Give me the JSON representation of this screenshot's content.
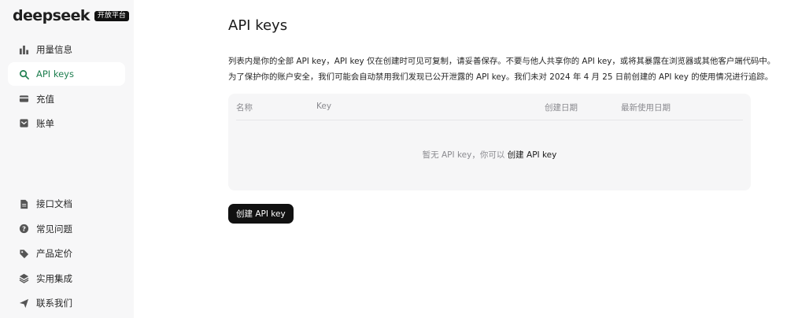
{
  "brand": {
    "name": "deepseek",
    "badge": "开放平台"
  },
  "sidebar": {
    "top_items": [
      {
        "label": "用量信息",
        "icon": "bar-chart-icon"
      },
      {
        "label": "API keys",
        "icon": "search-icon",
        "active": true
      },
      {
        "label": "充值",
        "icon": "wallet-icon"
      },
      {
        "label": "账单",
        "icon": "inbox-icon"
      }
    ],
    "bottom_items": [
      {
        "label": "接口文档",
        "icon": "document-icon"
      },
      {
        "label": "常见问题",
        "icon": "question-icon"
      },
      {
        "label": "产品定价",
        "icon": "tag-icon"
      },
      {
        "label": "实用集成",
        "icon": "layers-icon"
      },
      {
        "label": "联系我们",
        "icon": "send-icon"
      }
    ]
  },
  "main": {
    "title": "API keys",
    "description_line1": "列表内是你的全部 API key，API key 仅在创建时可见可复制，请妥善保存。不要与他人共享你的 API key，或将其暴露在浏览器或其他客户端代码中。",
    "description_line2": "为了保护你的账户安全，我们可能会自动禁用我们发现已公开泄露的 API key。我们未对 2024 年 4 月 25 日前创建的 API key 的使用情况进行追踪。",
    "table": {
      "columns": [
        "名称",
        "Key",
        "创建日期",
        "最新使用日期"
      ],
      "empty_text": "暂无 API key，你可以",
      "empty_link": "创建 API key"
    },
    "create_button": "创建 API key"
  },
  "colors": {
    "accent": "#1e7e4f",
    "button_bg": "#111111",
    "sidebar_bg": "#f7f7f8"
  }
}
